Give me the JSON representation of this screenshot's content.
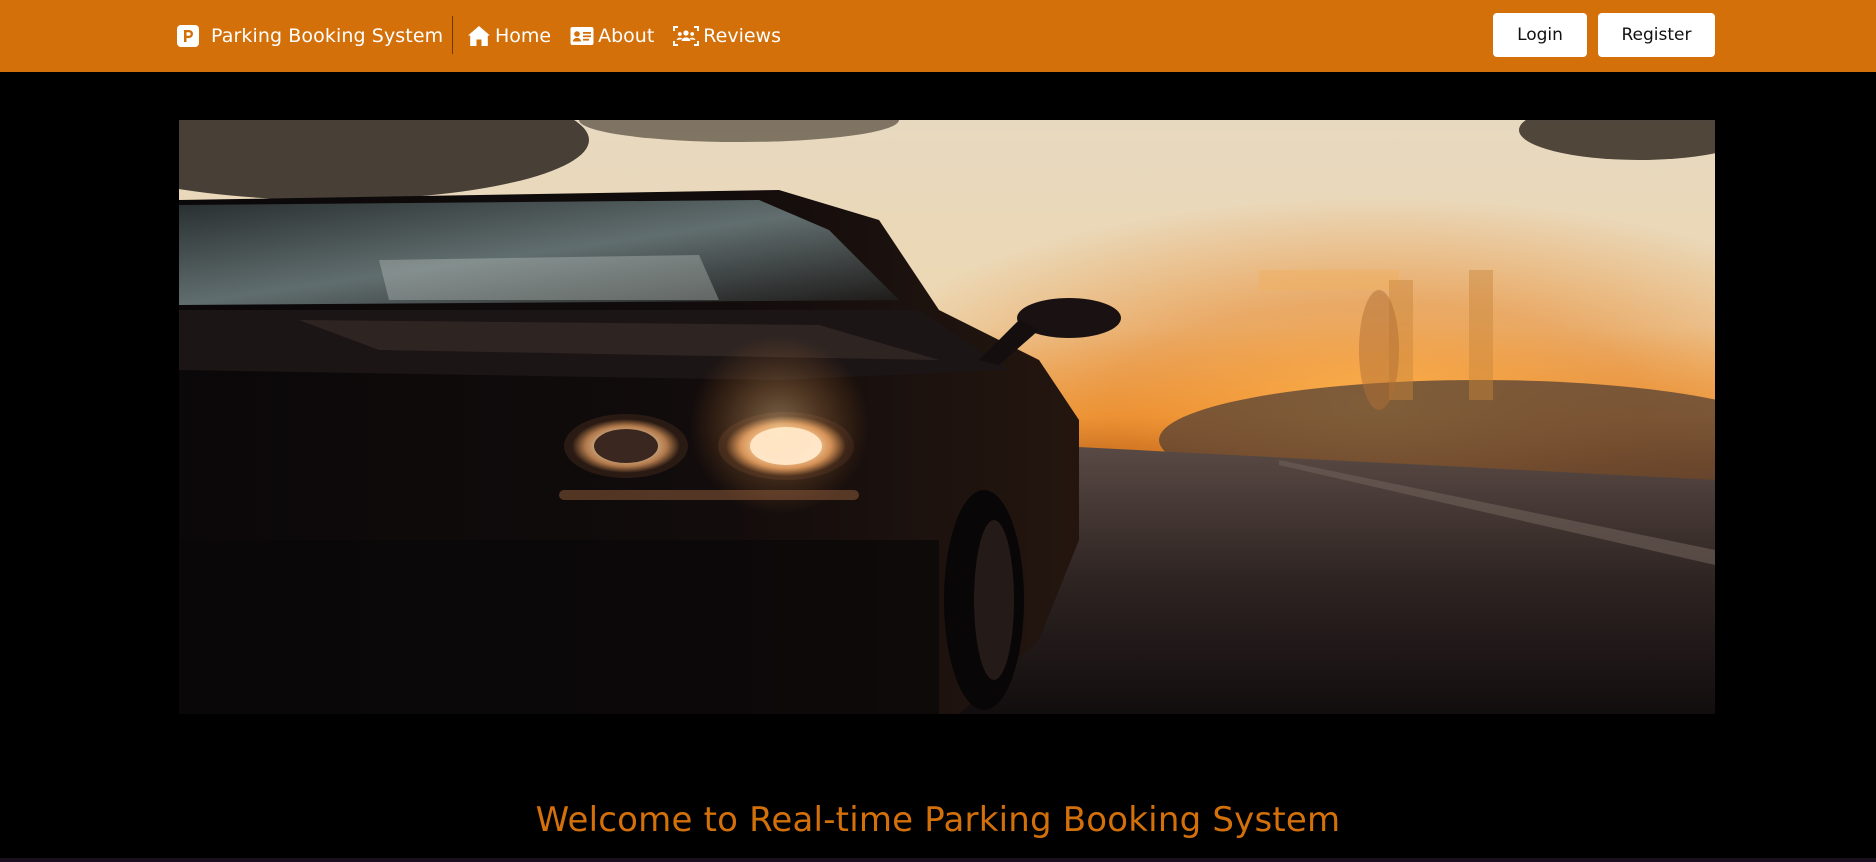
{
  "navbar": {
    "brand": {
      "icon": "parking-p-icon",
      "label": "Parking Booking System"
    },
    "links": [
      {
        "icon": "home-icon",
        "label": "Home"
      },
      {
        "icon": "id-card-icon",
        "label": "About"
      },
      {
        "icon": "users-scan-icon",
        "label": "Reviews"
      }
    ],
    "buttons": {
      "login": "Login",
      "register": "Register"
    }
  },
  "hero": {
    "image": "sports-car-at-sunset-photo"
  },
  "main": {
    "welcome_heading": "Welcome to Real-time Parking Booking System"
  },
  "colors": {
    "brand_orange": "#d3700a",
    "background": "#000000",
    "button_bg": "#ffffff",
    "text_light": "#ffffff"
  }
}
